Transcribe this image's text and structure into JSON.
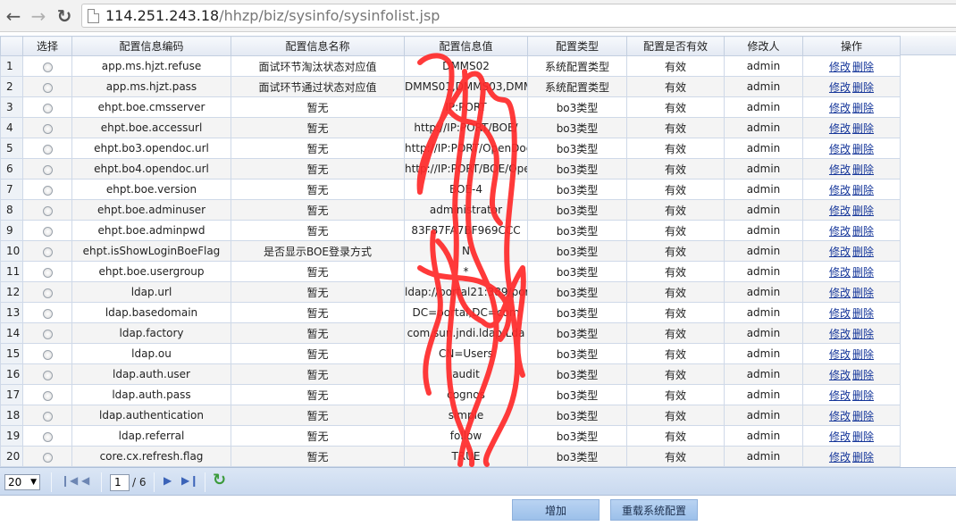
{
  "browser": {
    "url_host": "114.251.243.18",
    "url_path": "/hhzp/biz/sysinfo/sysinfolist.jsp"
  },
  "table": {
    "headers": [
      "选择",
      "配置信息编码",
      "配置信息名称",
      "配置信息值",
      "配置类型",
      "配置是否有效",
      "修改人",
      "操作"
    ],
    "rows": [
      {
        "num": "1",
        "code": "app.ms.hjzt.refuse",
        "name": "面试环节淘汰状态对应值",
        "value": "DMMS02",
        "type": "系统配置类型",
        "valid": "有效",
        "user": "admin"
      },
      {
        "num": "2",
        "code": "app.ms.hjzt.pass",
        "name": "面试环节通过状态对应值",
        "value": "DMMS01,DMMS03,DMM",
        "type": "系统配置类型",
        "valid": "有效",
        "user": "admin"
      },
      {
        "num": "3",
        "code": "ehpt.boe.cmsserver",
        "name": "暂无",
        "value": "IP:PORT",
        "type": "bo3类型",
        "valid": "有效",
        "user": "admin"
      },
      {
        "num": "4",
        "code": "ehpt.boe.accessurl",
        "name": "暂无",
        "value": "http://IP:PORT/BOE/",
        "type": "bo3类型",
        "valid": "有效",
        "user": "admin"
      },
      {
        "num": "5",
        "code": "ehpt.bo3.opendoc.url",
        "name": "暂无",
        "value": "http://IP:PORT/OpenDoc",
        "type": "bo3类型",
        "valid": "有效",
        "user": "admin"
      },
      {
        "num": "6",
        "code": "ehpt.bo4.opendoc.url",
        "name": "暂无",
        "value": "http://IP:PORT/BOE/OpenDoc",
        "type": "bo3类型",
        "valid": "有效",
        "user": "admin"
      },
      {
        "num": "7",
        "code": "ehpt.boe.version",
        "name": "暂无",
        "value": "BOE-4",
        "type": "bo3类型",
        "valid": "有效",
        "user": "admin"
      },
      {
        "num": "8",
        "code": "ehpt.boe.adminuser",
        "name": "暂无",
        "value": "administrator",
        "type": "bo3类型",
        "valid": "有效",
        "user": "admin"
      },
      {
        "num": "9",
        "code": "ehpt.boe.adminpwd",
        "name": "暂无",
        "value": "83F87FA7BF969CCC",
        "type": "bo3类型",
        "valid": "有效",
        "user": "admin"
      },
      {
        "num": "10",
        "code": "ehpt.isShowLoginBoeFlag",
        "name": "是否显示BOE登录方式",
        "value": "N",
        "type": "bo3类型",
        "valid": "有效",
        "user": "admin"
      },
      {
        "num": "11",
        "code": "ehpt.boe.usergroup",
        "name": "暂无",
        "value": "*",
        "type": "bo3类型",
        "valid": "有效",
        "user": "admin"
      },
      {
        "num": "12",
        "code": "ldap.url",
        "name": "暂无",
        "value": "ldap://portal21:389/port",
        "type": "bo3类型",
        "valid": "有效",
        "user": "admin"
      },
      {
        "num": "13",
        "code": "ldap.basedomain",
        "name": "暂无",
        "value": "DC=portal,DC=com",
        "type": "bo3类型",
        "valid": "有效",
        "user": "admin"
      },
      {
        "num": "14",
        "code": "ldap.factory",
        "name": "暂无",
        "value": "com.sun.jndi.ldap.Lda",
        "type": "bo3类型",
        "valid": "有效",
        "user": "admin"
      },
      {
        "num": "15",
        "code": "ldap.ou",
        "name": "暂无",
        "value": "CN=Users",
        "type": "bo3类型",
        "valid": "有效",
        "user": "admin"
      },
      {
        "num": "16",
        "code": "ldap.auth.user",
        "name": "暂无",
        "value": "audit",
        "type": "bo3类型",
        "valid": "有效",
        "user": "admin"
      },
      {
        "num": "17",
        "code": "ldap.auth.pass",
        "name": "暂无",
        "value": "cognos",
        "type": "bo3类型",
        "valid": "有效",
        "user": "admin"
      },
      {
        "num": "18",
        "code": "ldap.authentication",
        "name": "暂无",
        "value": "simple",
        "type": "bo3类型",
        "valid": "有效",
        "user": "admin"
      },
      {
        "num": "19",
        "code": "ldap.referral",
        "name": "暂无",
        "value": "follow",
        "type": "bo3类型",
        "valid": "有效",
        "user": "admin"
      },
      {
        "num": "20",
        "code": "core.cx.refresh.flag",
        "name": "暂无",
        "value": "TRUE",
        "type": "bo3类型",
        "valid": "有效",
        "user": "admin"
      }
    ],
    "action_edit": "修改",
    "action_delete": "删除"
  },
  "pager": {
    "page_size": "20",
    "current_page": "1",
    "total_pages": "/ 6"
  },
  "buttons": {
    "add": "增加",
    "reload": "重载系统配置"
  },
  "colors": {
    "header_bg": "#e3e9f3",
    "link": "#15369a",
    "button_bg": "#9cc0ea",
    "scribble": "#ff2a2a"
  }
}
